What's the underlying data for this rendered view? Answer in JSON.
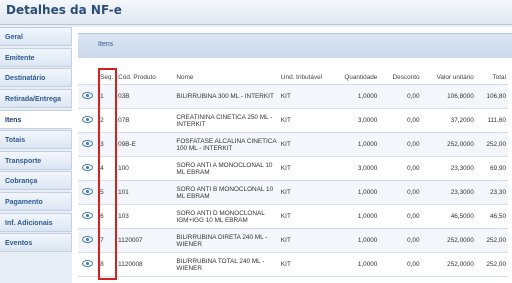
{
  "window": {
    "title": "Detalhes da NF-e"
  },
  "sidebar": {
    "items": [
      {
        "label": "Geral"
      },
      {
        "label": "Emitente"
      },
      {
        "label": "Destinatário"
      },
      {
        "label": "Retirada/Entrega"
      },
      {
        "label": "Itens"
      },
      {
        "label": "Totais"
      },
      {
        "label": "Transporte"
      },
      {
        "label": "Cobrança"
      },
      {
        "label": "Pagamento"
      },
      {
        "label": "Inf. Adicionais"
      },
      {
        "label": "Eventos"
      }
    ]
  },
  "main": {
    "section_title": "Itens",
    "columns": [
      "Seq.",
      "Cód. Produto",
      "Nome",
      "Und. tributável",
      "Quantidade",
      "Desconto",
      "Valor unitário",
      "Total"
    ],
    "rows": [
      {
        "seq": "1",
        "codigo": "03B",
        "nome": "BILIRRUBINA 300 ML - INTERKIT",
        "und": "KIT",
        "quantidade": "1,0000",
        "desconto": "0,00",
        "valor_unitario": "106,8000",
        "total": "106,80"
      },
      {
        "seq": "2",
        "codigo": "07B",
        "nome": "CREATININA CINETICA 250 ML - INTERKIT",
        "und": "KIT",
        "quantidade": "3,0000",
        "desconto": "0,00",
        "valor_unitario": "37,2000",
        "total": "111,60"
      },
      {
        "seq": "3",
        "codigo": "09B-E",
        "nome": "FOSFATASE ALCALINA CINETICA 100 ML - INTERKIT",
        "und": "KIT",
        "quantidade": "1,0000",
        "desconto": "0,00",
        "valor_unitario": "252,0000",
        "total": "252,00"
      },
      {
        "seq": "4",
        "codigo": "100",
        "nome": "SORO ANTI A MONOCLONAL 10 ML EBRAM",
        "und": "KIT",
        "quantidade": "3,0000",
        "desconto": "0,00",
        "valor_unitario": "23,3000",
        "total": "69,90"
      },
      {
        "seq": "5",
        "codigo": "101",
        "nome": "SORO ANTI B MONOCLONAL 10 ML EBRAM",
        "und": "KIT",
        "quantidade": "1,0000",
        "desconto": "0,00",
        "valor_unitario": "23,3000",
        "total": "23,30"
      },
      {
        "seq": "6",
        "codigo": "103",
        "nome": "SORO ANTI D MONOCLONAL IGM+IGG 10 ML EBRAM",
        "und": "KIT",
        "quantidade": "1,0000",
        "desconto": "0,00",
        "valor_unitario": "46,5000",
        "total": "46,50"
      },
      {
        "seq": "7",
        "codigo": "1120007",
        "nome": "BILIRRUBINA DIRETA 240 ML - WIENER",
        "und": "KIT",
        "quantidade": "1,0000",
        "desconto": "0,00",
        "valor_unitario": "252,0000",
        "total": "252,00"
      },
      {
        "seq": "8",
        "codigo": "1120008",
        "nome": "BILIRRUBINA TOTAL 240 ML - WIENER",
        "und": "KIT",
        "quantidade": "1,0000",
        "desconto": "0,00",
        "valor_unitario": "252,0000",
        "total": "252,00"
      }
    ]
  },
  "icons": {
    "row_view": "eye-icon"
  },
  "colors": {
    "highlight_box": "#d62020",
    "accent": "#2d5a93"
  }
}
